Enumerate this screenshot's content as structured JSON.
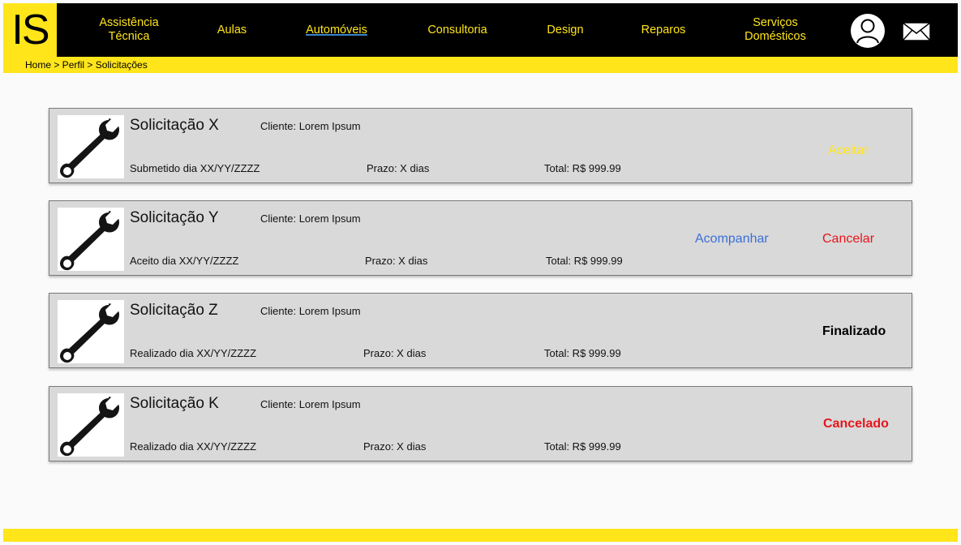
{
  "header": {
    "logo": "IS",
    "nav": [
      {
        "label": "Assistência\nTécnica",
        "active": false
      },
      {
        "label": "Aulas",
        "active": false
      },
      {
        "label": "Automóveis",
        "active": true
      },
      {
        "label": "Consultoria",
        "active": false
      },
      {
        "label": "Design",
        "active": false
      },
      {
        "label": "Reparos",
        "active": false
      },
      {
        "label": "Serviços\nDomésticos",
        "active": false
      }
    ],
    "profile_icon": "user-icon",
    "mail_icon": "mail-icon"
  },
  "breadcrumb": "Home > Perfil > Solicitações",
  "colors": {
    "yellow": "#ffe51a",
    "black": "#000000",
    "card_bg": "#d9d9d9",
    "link_blue": "#3b6fd9",
    "red": "#e8141c"
  },
  "requests": [
    {
      "title": "Solicitação X",
      "client": "Cliente: Lorem Ipsum",
      "date": "Submetido dia XX/YY/ZZZZ",
      "prazo": "Prazo: X dias",
      "total": "Total: R$ 999.99",
      "icon": "wrench-icon",
      "actions": [
        {
          "label": "Aceitar",
          "color": "#ffe51a"
        }
      ],
      "status": ""
    },
    {
      "title": "Solicitação Y",
      "client": "Cliente: Lorem Ipsum",
      "date": "Aceito dia XX/YY/ZZZZ",
      "prazo": "Prazo: X dias",
      "total": "Total: R$ 999.99",
      "icon": "wrench-icon",
      "actions": [
        {
          "label": "Acompanhar",
          "color": "#3b6fd9"
        },
        {
          "label": "Cancelar",
          "color": "#e8141c"
        }
      ],
      "status": ""
    },
    {
      "title": "Solicitação Z",
      "client": "Cliente: Lorem Ipsum",
      "date": "Realizado dia XX/YY/ZZZZ",
      "prazo": "Prazo: X dias",
      "total": "Total: R$ 999.99",
      "icon": "wrench-icon",
      "actions": [],
      "status": "Finalizado",
      "status_color": "#000000"
    },
    {
      "title": "Solicitação K",
      "client": "Cliente: Lorem Ipsum",
      "date": "Realizado dia XX/YY/ZZZZ",
      "prazo": "Prazo: X dias",
      "total": "Total: R$ 999.99",
      "icon": "wrench-icon",
      "actions": [],
      "status": "Cancelado",
      "status_color": "#e8141c"
    }
  ]
}
